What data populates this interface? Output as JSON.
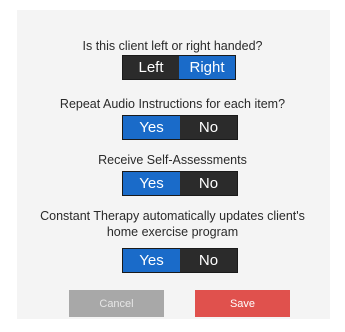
{
  "handedness": {
    "question": "Is this client left or right handed?",
    "options": [
      "Left",
      "Right"
    ],
    "selected": "Right"
  },
  "repeat_audio": {
    "question": "Repeat Audio Instructions for each item?",
    "options": [
      "Yes",
      "No"
    ],
    "selected": "Yes"
  },
  "self_assessments": {
    "question": "Receive Self-Assessments",
    "options": [
      "Yes",
      "No"
    ],
    "selected": "Yes"
  },
  "home_program": {
    "question_line1": "Constant Therapy automatically updates client's",
    "question_line2": "home exercise program",
    "options": [
      "Yes",
      "No"
    ],
    "selected": "Yes"
  },
  "actions": {
    "cancel_label": "Cancel",
    "save_label": "Save"
  },
  "colors": {
    "selected_blue": "#1a6bc9",
    "unselected_dark": "#2b2b2b",
    "save_red": "#e0514d",
    "cancel_gray": "#a8a8a8"
  }
}
